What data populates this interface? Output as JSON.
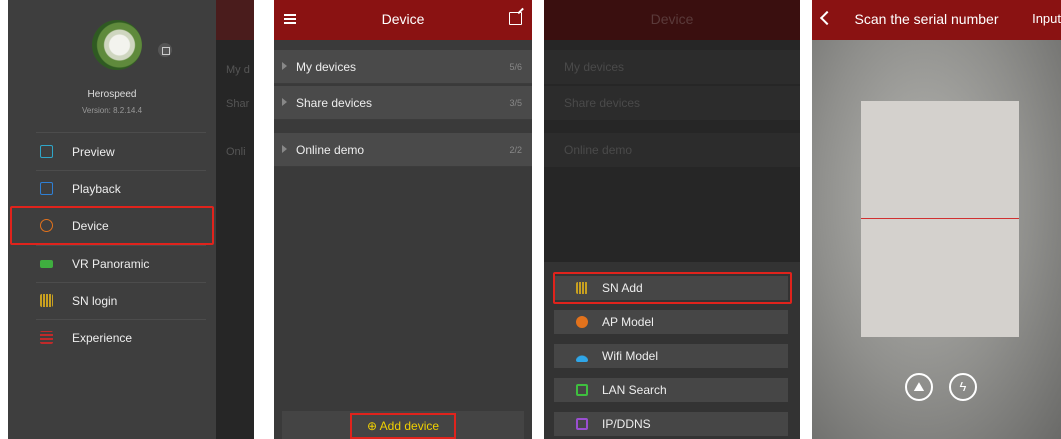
{
  "panel1": {
    "username": "Herospeed",
    "version": "Version: 8.2.14.4",
    "menu": [
      {
        "label": "Preview",
        "icon": "preview-icon",
        "color": "#2fa6c8"
      },
      {
        "label": "Playback",
        "icon": "playback-icon",
        "color": "#2f7fd4"
      },
      {
        "label": "Device",
        "icon": "device-gear-icon",
        "color": "#e2721c"
      },
      {
        "label": "VR Panoramic",
        "icon": "vr-360-icon",
        "color": "#3fae3f"
      },
      {
        "label": "SN login",
        "icon": "barcode-icon",
        "color": "#c8a020"
      },
      {
        "label": "Experience",
        "icon": "experience-icon",
        "color": "#c02a2a"
      }
    ],
    "background_peek": [
      "My d",
      "Shar",
      "Onli"
    ]
  },
  "panel2": {
    "title": "Device",
    "rows": [
      {
        "label": "My devices",
        "count": "5/6"
      },
      {
        "label": "Share devices",
        "count": "3/5"
      },
      {
        "label": "Online demo",
        "count": "2/2"
      }
    ],
    "add_device": "Add device"
  },
  "panel3": {
    "title": "Device",
    "dim_rows": [
      "My devices",
      "Share devices",
      "Online demo"
    ],
    "options": [
      {
        "label": "SN Add",
        "icon": "barcode-icon",
        "color": "#c8a020"
      },
      {
        "label": "AP Model",
        "icon": "globe-icon",
        "color": "#e2721c"
      },
      {
        "label": "Wifi Model",
        "icon": "wifi-icon",
        "color": "#2fa6e8"
      },
      {
        "label": "LAN Search",
        "icon": "lan-icon",
        "color": "#3fbf3f"
      },
      {
        "label": "IP/DDNS",
        "icon": "ip-ddns-icon",
        "color": "#9a4fd0"
      }
    ]
  },
  "panel4": {
    "title": "Scan the serial number",
    "input": "Input",
    "album_glyph": "⛰",
    "flash_glyph": "ϟ"
  },
  "colors": {
    "brand_red": "#8a1212",
    "highlight": "#e0231c",
    "accent_yellow": "#f0d000"
  }
}
